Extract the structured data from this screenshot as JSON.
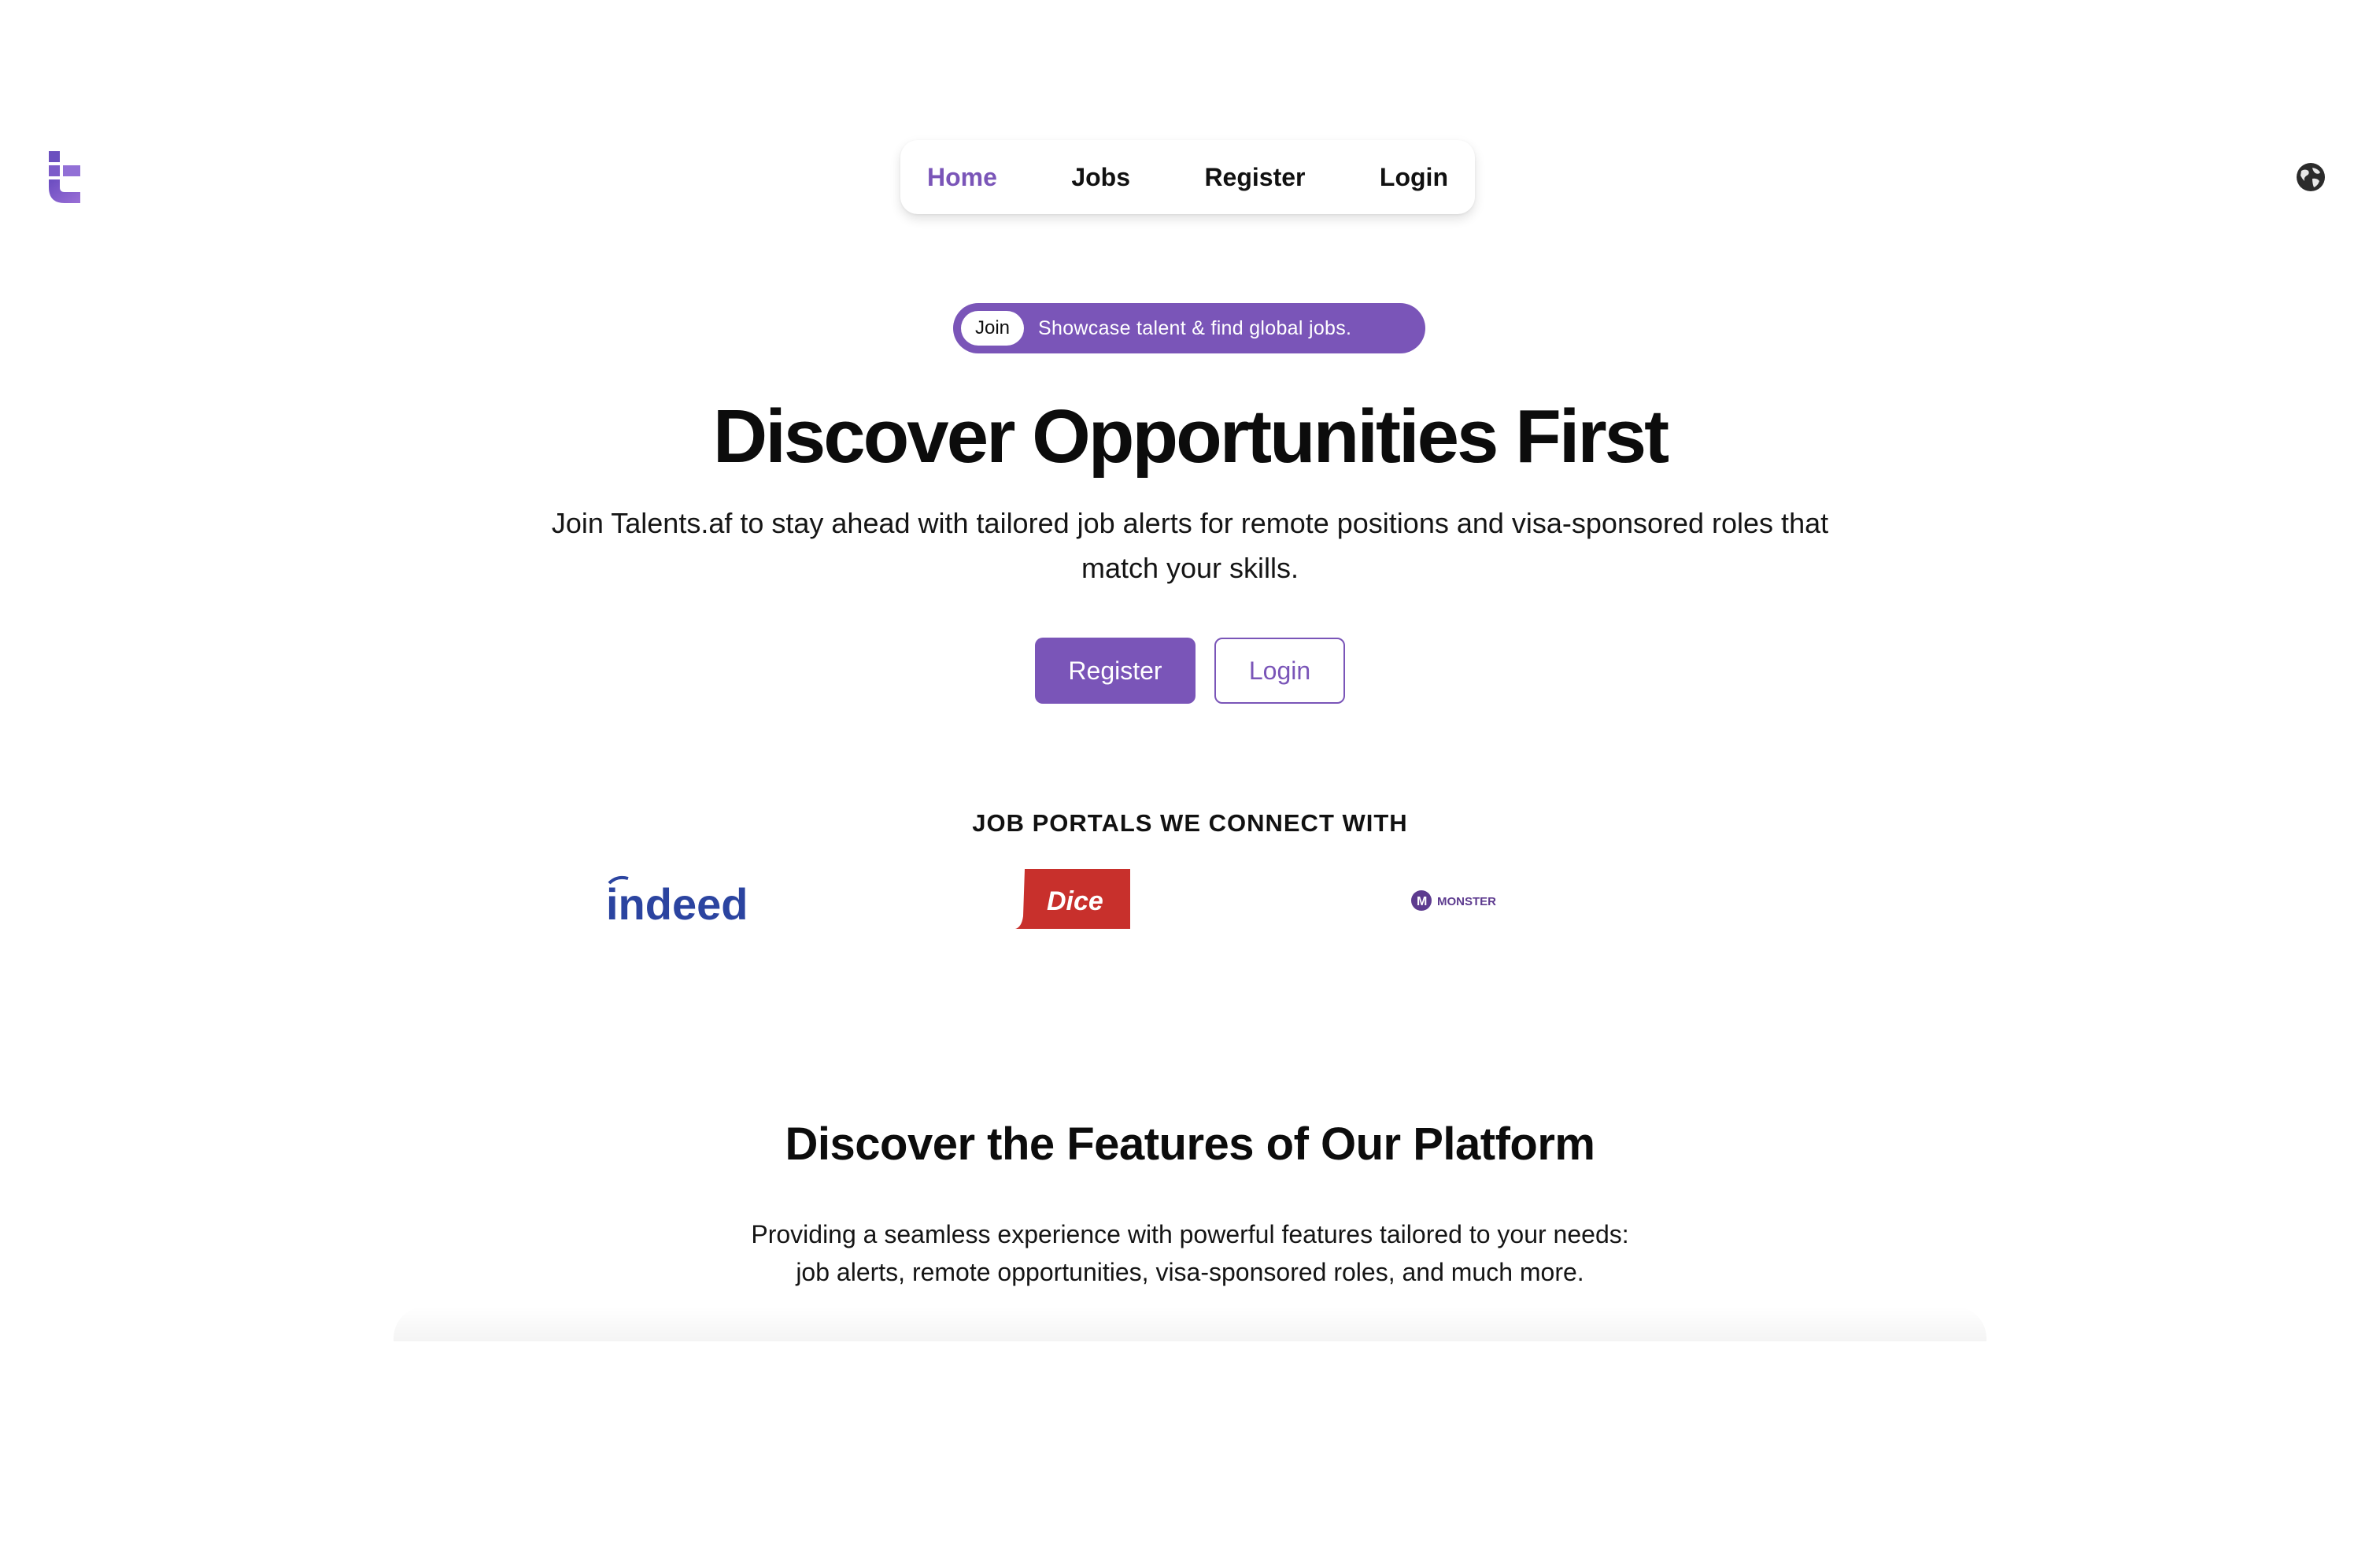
{
  "brand": {
    "logo_icon": "talents-logo-icon",
    "accent_color": "#7a55b8"
  },
  "nav": {
    "items": [
      {
        "label": "Home",
        "active": true
      },
      {
        "label": "Jobs",
        "active": false
      },
      {
        "label": "Register",
        "active": false
      },
      {
        "label": "Login",
        "active": false
      }
    ],
    "language_icon": "globe-icon"
  },
  "announcement": {
    "chip_label": "Join",
    "text": "Showcase talent & find global jobs."
  },
  "hero": {
    "title": "Discover Opportunities First",
    "subtitle": "Join Talents.af to stay ahead with tailored job alerts for remote positions and visa-sponsored roles that match your skills.",
    "register_label": "Register",
    "login_label": "Login"
  },
  "portals": {
    "heading": "JOB PORTALS WE CONNECT WITH",
    "logos": [
      {
        "name": "indeed",
        "text": "indeed",
        "color": "#2b44a0"
      },
      {
        "name": "dice",
        "text": "Dice",
        "color": "#c8302c"
      },
      {
        "name": "monster",
        "text": "MONSTER",
        "color": "#5d3b8f"
      }
    ]
  },
  "features": {
    "title": "Discover the Features of Our Platform",
    "subtitle_line1": "Providing a seamless experience with powerful features tailored to your needs:",
    "subtitle_line2": "job alerts, remote opportunities, visa-sponsored roles, and much more."
  }
}
